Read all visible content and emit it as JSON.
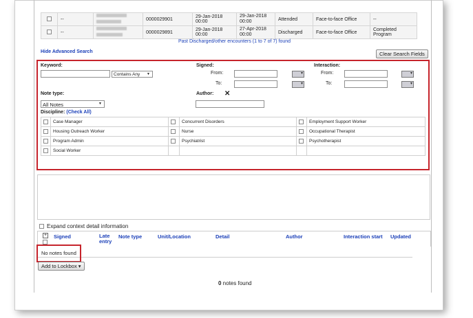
{
  "encounters": [
    {
      "name_hidden": true,
      "dash": "--",
      "id": "0000029901",
      "start": "29-Jan-2018 00:00",
      "end": "29-Jan-2018 00:00",
      "status": "Attended",
      "type": "Face-to-face Office",
      "reason": "--"
    },
    {
      "name_hidden": true,
      "dash": "--",
      "id": "0000029891",
      "start": "29-Jan-2018 00:00",
      "end": "27-Apr-2018 00:00",
      "status": "Discharged",
      "type": "Face-to-face Office",
      "reason": "Completed Program"
    }
  ],
  "past_link": "Past Discharged/other encounters (1 to 7 of 7) found",
  "hide_advanced": "Hide Advanced Search",
  "clear_button": "Clear Search Fields",
  "search": {
    "keyword_label": "Keyword:",
    "keyword_value": "",
    "contains_value": "Contains Any",
    "signed_label": "Signed:",
    "from_label": "From:",
    "to_label": "To:",
    "interaction_label": "Interaction:",
    "note_type_label": "Note type:",
    "note_type_value": "All Notes",
    "author_label": "Author:",
    "author_clear": "✕",
    "discipline_label": "Discipline:",
    "check_all": "(Check All)"
  },
  "disciplines": [
    [
      "Case Manager",
      "Concurrent Disorders",
      "Employment Support Worker"
    ],
    [
      "Housing Outreach Worker",
      "Nurse",
      "Occupational Therapist"
    ],
    [
      "Program Admin",
      "Psychiatrist",
      "Psychotherapist"
    ],
    [
      "Social Worker",
      "",
      ""
    ]
  ],
  "expand_label": "Expand context detail information",
  "columns": {
    "plus": "+",
    "signed": "Signed",
    "late_entry": "Late entry",
    "note_type": "Note type",
    "unit": "Unit/Location",
    "detail": "Detail",
    "author": "Author",
    "interaction_start": "Interaction start",
    "updated": "Updated"
  },
  "no_notes": "No notes found",
  "add_lockbox": "Add to Lockbox",
  "notes_count": "0",
  "notes_found_suffix": " notes found"
}
